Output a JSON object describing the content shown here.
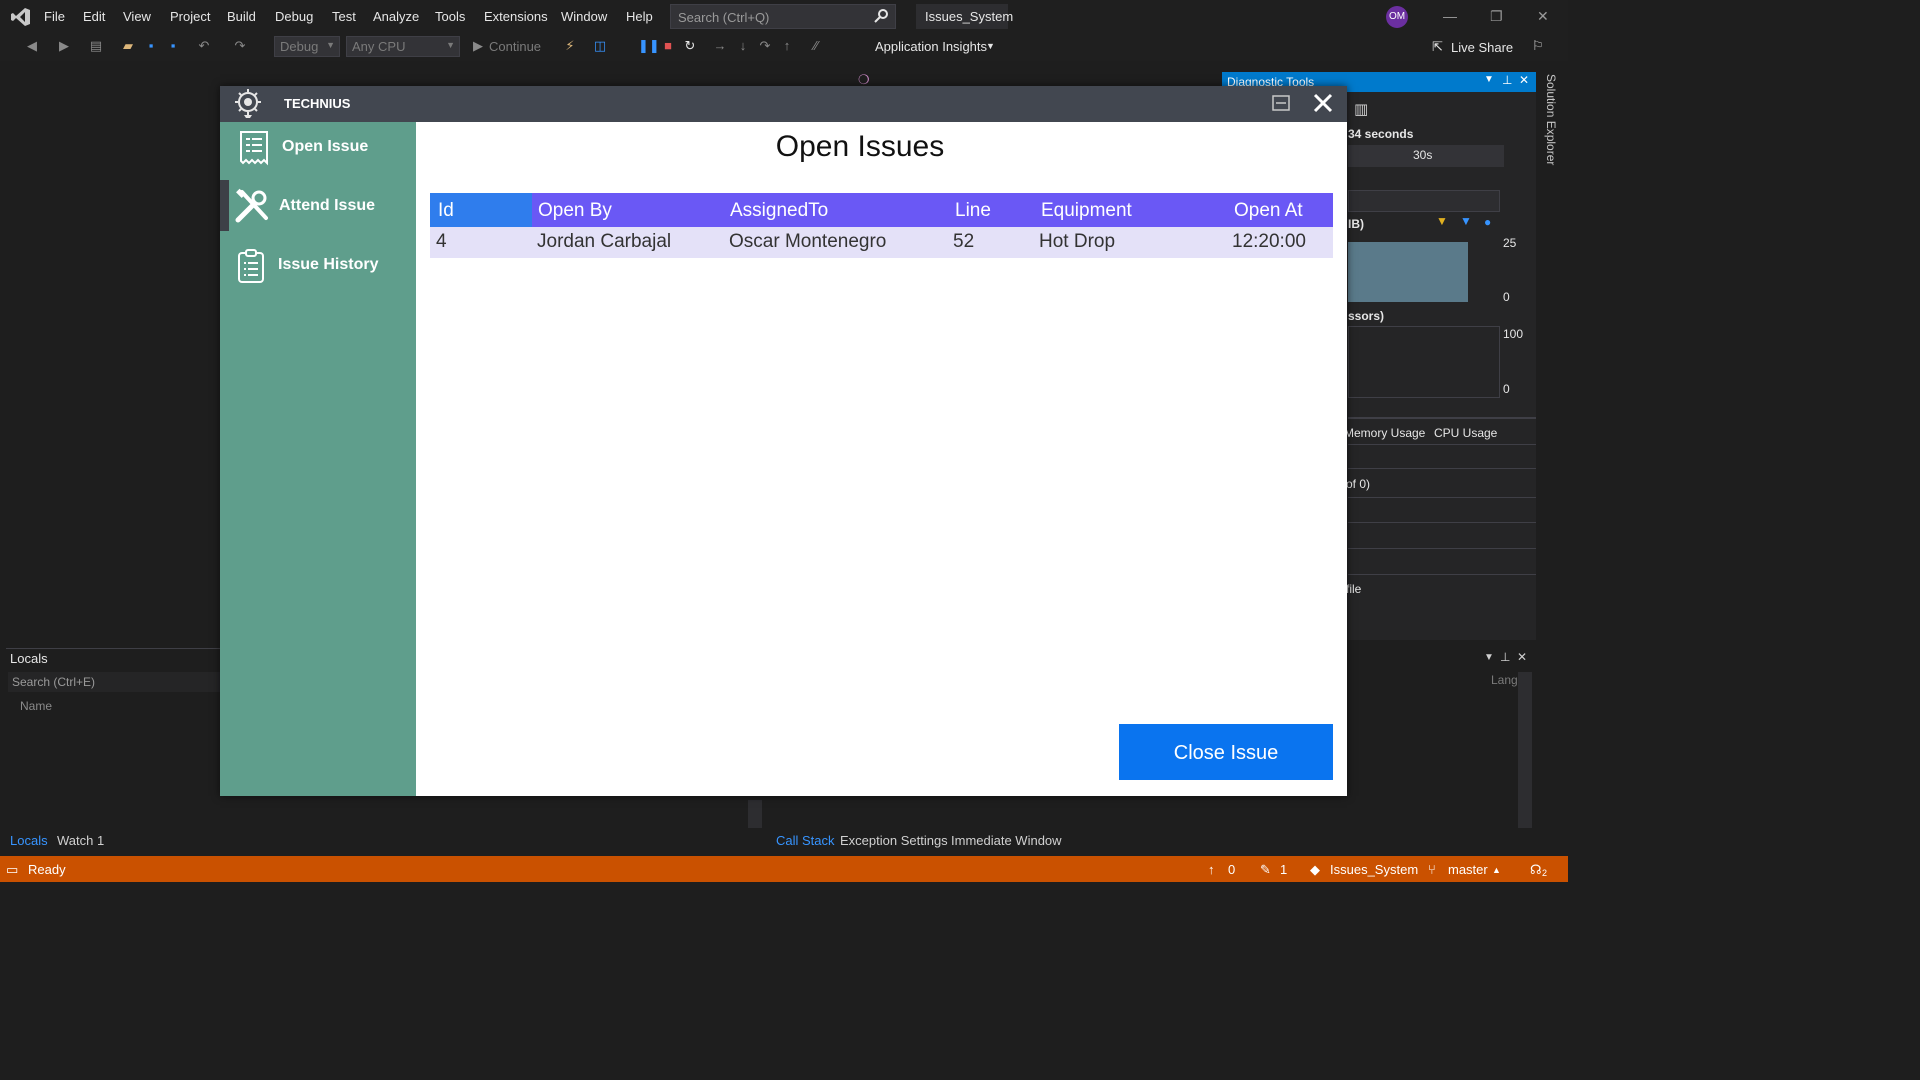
{
  "ide": {
    "menu": [
      "File",
      "Edit",
      "View",
      "Project",
      "Build",
      "Debug",
      "Test",
      "Analyze",
      "Tools",
      "Extensions",
      "Window",
      "Help"
    ],
    "search_placeholder": "Search (Ctrl+Q)",
    "solution_name": "Issues_System",
    "user_initials": "OM",
    "toolbar": {
      "config": "Debug",
      "platform": "Any CPU",
      "continue_label": "Continue",
      "app_insights": "Application Insights",
      "live_share": "Live Share"
    },
    "diagnostic": {
      "title": "Diagnostic Tools",
      "session": "34 seconds",
      "time_tick": "30s",
      "mem_label": "IB)",
      "mem_max": "25",
      "mem_min": "0",
      "cpu_label": "ssors)",
      "cpu_max": "100",
      "cpu_min": "0",
      "tab_memory": "Memory Usage",
      "tab_cpu": "CPU Usage",
      "events": "of 0)",
      "profile": "file"
    },
    "solution_explorer": "Solution Explorer",
    "locals": {
      "title": "Locals",
      "search_placeholder": "Search (Ctrl+E)",
      "name_col": "Name",
      "lang_col": "Lang"
    },
    "bottom_tabs_left": [
      "Locals",
      "Watch 1"
    ],
    "bottom_tabs_right": [
      "Call Stack",
      "Exception Settings",
      "Immediate Window"
    ],
    "status": {
      "ready": "Ready",
      "up_count": "0",
      "edit_count": "1",
      "repo": "Issues_System",
      "branch": "master",
      "notifications": "2"
    }
  },
  "app": {
    "name": "TECHNIUS",
    "nav": [
      {
        "label": "Open Issue",
        "icon": "document-list-icon"
      },
      {
        "label": "Attend Issue",
        "icon": "tools-icon"
      },
      {
        "label": "Issue History",
        "icon": "clipboard-icon"
      }
    ],
    "page_title": "Open Issues",
    "table": {
      "columns": [
        "Id",
        "Open By",
        "AssignedTo",
        "Line",
        "Equipment",
        "Open At"
      ],
      "rows": [
        [
          "4",
          "Jordan Carbajal",
          "Oscar Montenegro",
          "52",
          "Hot Drop",
          "12:20:00"
        ]
      ]
    },
    "close_button": "Close Issue",
    "colors": {
      "sidebar": "#5f9e8c",
      "titlebar": "#424750",
      "header": "#6a58f5",
      "id_header": "#2f7ded",
      "row": "#e4e1f8",
      "button": "#0a74ef"
    }
  }
}
